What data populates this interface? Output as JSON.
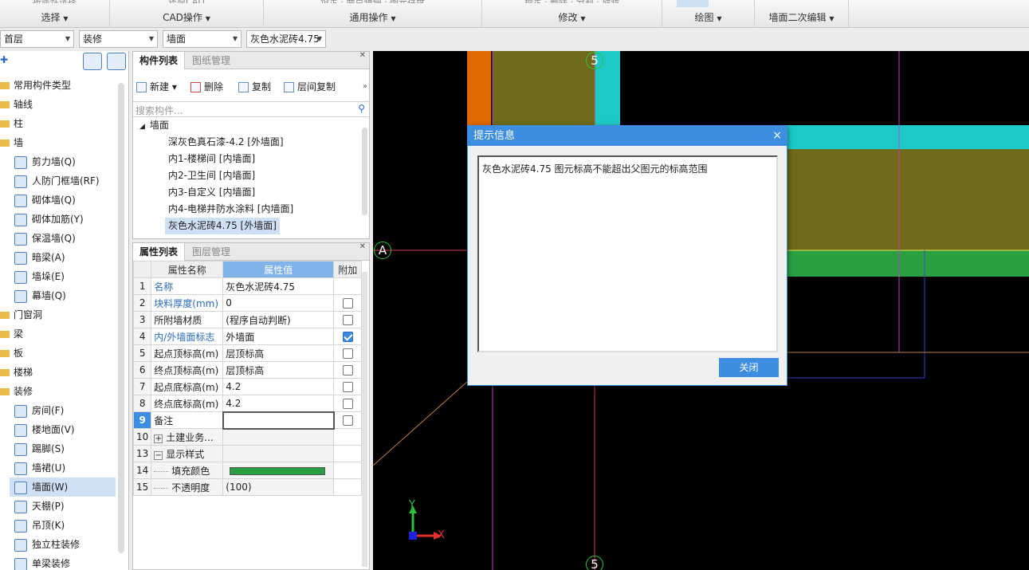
{
  "ribbon": {
    "groups": [
      {
        "label": "选择",
        "cut": "按属性选择"
      },
      {
        "label": "CAD操作",
        "cut": "还原CAD"
      },
      {
        "label": "通用操作",
        "cut": "设定  · 两点辅轴  · 图元存盘"
      },
      {
        "label": "修改",
        "cut": "锁定  · 删除  · 分割  · 旋转"
      },
      {
        "label": "绘图",
        "cut": ""
      },
      {
        "label": "墙面二次编辑",
        "cut": ""
      }
    ]
  },
  "selectors": {
    "floor": "首层",
    "category": "装修",
    "type": "墙面",
    "item": "灰色水泥砖4.75"
  },
  "tree": {
    "items": [
      {
        "label": "常用构件类型",
        "level": 0
      },
      {
        "label": "轴线",
        "level": 0
      },
      {
        "label": "柱",
        "level": 0
      },
      {
        "label": "墙",
        "level": 0
      },
      {
        "label": "剪力墙(Q)",
        "level": 1
      },
      {
        "label": "人防门框墙(RF)",
        "level": 1
      },
      {
        "label": "砌体墙(Q)",
        "level": 1
      },
      {
        "label": "砌体加筋(Y)",
        "level": 1
      },
      {
        "label": "保温墙(Q)",
        "level": 1
      },
      {
        "label": "暗梁(A)",
        "level": 1
      },
      {
        "label": "墙垛(E)",
        "level": 1
      },
      {
        "label": "幕墙(Q)",
        "level": 1
      },
      {
        "label": "门窗洞",
        "level": 0
      },
      {
        "label": "梁",
        "level": 0
      },
      {
        "label": "板",
        "level": 0
      },
      {
        "label": "楼梯",
        "level": 0
      },
      {
        "label": "装修",
        "level": 0
      },
      {
        "label": "房间(F)",
        "level": 1
      },
      {
        "label": "楼地面(V)",
        "level": 1
      },
      {
        "label": "踢脚(S)",
        "level": 1
      },
      {
        "label": "墙裙(U)",
        "level": 1
      },
      {
        "label": "墙面(W)",
        "level": 1,
        "selected": true
      },
      {
        "label": "天棚(P)",
        "level": 1
      },
      {
        "label": "吊顶(K)",
        "level": 1
      },
      {
        "label": "独立柱装修",
        "level": 1
      },
      {
        "label": "单梁装修",
        "level": 1
      }
    ]
  },
  "component_panel": {
    "tabs": [
      "构件列表",
      "图纸管理"
    ],
    "toolbar": {
      "new": "新建",
      "delete": "删除",
      "copy": "复制",
      "floor_copy": "层间复制"
    },
    "search_placeholder": "搜索构件...",
    "group": "墙面",
    "items": [
      "深灰色真石漆-4.2 [外墙面]",
      "内1-楼梯间 [内墙面]",
      "内2-卫生间 [内墙面]",
      "内3-自定义 [内墙面]",
      "内4-电梯井防水涂料 [内墙面]",
      "灰色水泥砖4.75 [外墙面]"
    ]
  },
  "property_panel": {
    "tabs": [
      "属性列表",
      "图层管理"
    ],
    "headers": [
      "属性名称",
      "属性值",
      "附加"
    ],
    "rows": [
      {
        "n": "1",
        "name": "名称",
        "value": "灰色水泥砖4.75",
        "blue": true,
        "check": null
      },
      {
        "n": "2",
        "name": "块料厚度(mm)",
        "value": "0",
        "blue": true,
        "check": false
      },
      {
        "n": "3",
        "name": "所附墙材质",
        "value": "(程序自动判断)",
        "blue": false,
        "check": false
      },
      {
        "n": "4",
        "name": "内/外墙面标志",
        "value": "外墙面",
        "blue": true,
        "check": true
      },
      {
        "n": "5",
        "name": "起点顶标高(m)",
        "value": "层顶标高",
        "blue": false,
        "check": false
      },
      {
        "n": "6",
        "name": "终点顶标高(m)",
        "value": "层顶标高",
        "blue": false,
        "check": false
      },
      {
        "n": "7",
        "name": "起点底标高(m)",
        "value": "4.2",
        "blue": false,
        "check": false
      },
      {
        "n": "8",
        "name": "终点底标高(m)",
        "value": "4.2",
        "blue": false,
        "check": false
      },
      {
        "n": "9",
        "name": "备注",
        "value": "",
        "blue": false,
        "check": false
      },
      {
        "n": "10",
        "name": "土建业务...",
        "value": "",
        "blue": false,
        "check": null,
        "expand": "+"
      },
      {
        "n": "13",
        "name": "显示样式",
        "value": "",
        "blue": false,
        "check": null,
        "expand": "−"
      },
      {
        "n": "14",
        "name": "填充颜色",
        "value": "",
        "blue": false,
        "check": null,
        "sub": true,
        "color": "#2aa043"
      },
      {
        "n": "15",
        "name": "不透明度",
        "value": "(100)",
        "blue": false,
        "check": null,
        "sub": true
      }
    ]
  },
  "canvas": {
    "axis_top": "5",
    "axis_left": "A",
    "axis_bottom": "5",
    "y_label": "Y",
    "x_label": "X"
  },
  "dialog": {
    "title": "提示信息",
    "message": "灰色水泥砖4.75 图元标高不能超出父图元的标高范围",
    "button": "关闭",
    "close": "×"
  }
}
